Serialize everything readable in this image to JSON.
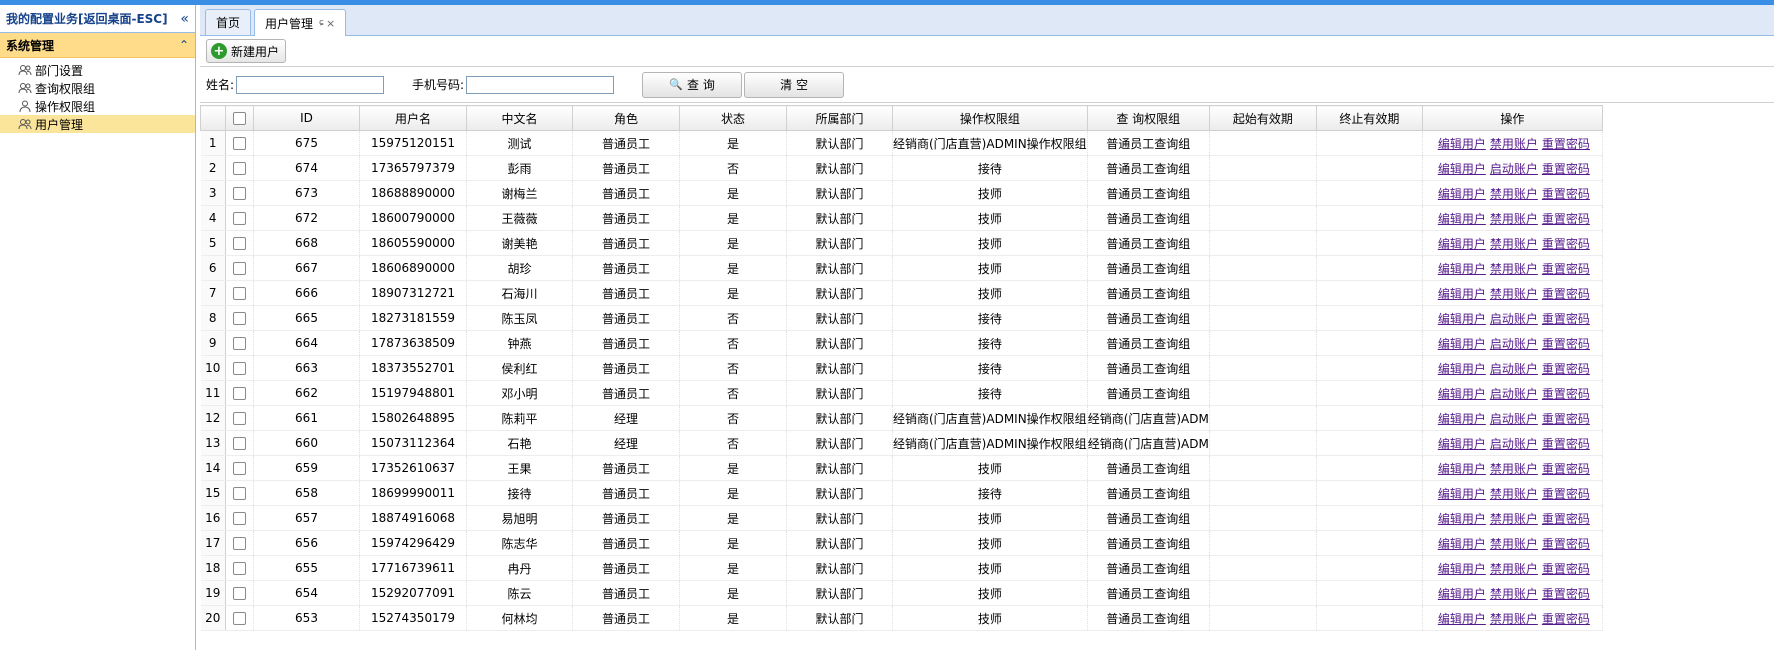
{
  "sidebar": {
    "title": "我的配置业务[返回桌面-ESC]",
    "collapse_icon": "«",
    "group_title": "系统管理",
    "group_toggle": "⌃",
    "items": [
      {
        "label": "部门设置",
        "icon": "users-icon"
      },
      {
        "label": "查询权限组",
        "icon": "users-icon"
      },
      {
        "label": "操作权限组",
        "icon": "user-icon"
      },
      {
        "label": "用户管理",
        "icon": "users-icon"
      }
    ]
  },
  "tabs": [
    {
      "label": "首页"
    },
    {
      "label": "用户管理",
      "pin": "ɕ",
      "close": "×"
    }
  ],
  "toolbar": {
    "new_user_label": "新建用户",
    "plus": "+"
  },
  "search": {
    "name_label": "姓名:",
    "phone_label": "手机号码:",
    "query_label": "查 询",
    "clear_label": "清 空",
    "search_icon": "🔍"
  },
  "table": {
    "headers": [
      "ID",
      "用户名",
      "中文名",
      "角色",
      "状态",
      "所属部门",
      "操作权限组",
      "查 询权限组",
      "起始有效期",
      "终止有效期",
      "操作"
    ],
    "rows": [
      {
        "n": "1",
        "id": "675",
        "user": "15975120151",
        "name": "测试",
        "role": "普通员工",
        "status": "是",
        "dept": "默认部门",
        "op": "经销商(门店直营)ADMIN操作权限组",
        "q": "普通员工查询组",
        "a2": "禁用账户"
      },
      {
        "n": "2",
        "id": "674",
        "user": "17365797379",
        "name": "彭雨",
        "role": "普通员工",
        "status": "否",
        "dept": "默认部门",
        "op": "接待",
        "q": "普通员工查询组",
        "a2": "启动账户"
      },
      {
        "n": "3",
        "id": "673",
        "user": "18688890000",
        "name": "谢梅兰",
        "role": "普通员工",
        "status": "是",
        "dept": "默认部门",
        "op": "技师",
        "q": "普通员工查询组",
        "a2": "禁用账户"
      },
      {
        "n": "4",
        "id": "672",
        "user": "18600790000",
        "name": "王薇薇",
        "role": "普通员工",
        "status": "是",
        "dept": "默认部门",
        "op": "技师",
        "q": "普通员工查询组",
        "a2": "禁用账户"
      },
      {
        "n": "5",
        "id": "668",
        "user": "18605590000",
        "name": "谢美艳",
        "role": "普通员工",
        "status": "是",
        "dept": "默认部门",
        "op": "技师",
        "q": "普通员工查询组",
        "a2": "禁用账户"
      },
      {
        "n": "6",
        "id": "667",
        "user": "18606890000",
        "name": "胡珍",
        "role": "普通员工",
        "status": "是",
        "dept": "默认部门",
        "op": "技师",
        "q": "普通员工查询组",
        "a2": "禁用账户"
      },
      {
        "n": "7",
        "id": "666",
        "user": "18907312721",
        "name": "石海川",
        "role": "普通员工",
        "status": "是",
        "dept": "默认部门",
        "op": "技师",
        "q": "普通员工查询组",
        "a2": "禁用账户"
      },
      {
        "n": "8",
        "id": "665",
        "user": "18273181559",
        "name": "陈玉凤",
        "role": "普通员工",
        "status": "否",
        "dept": "默认部门",
        "op": "接待",
        "q": "普通员工查询组",
        "a2": "启动账户"
      },
      {
        "n": "9",
        "id": "664",
        "user": "17873638509",
        "name": "钟燕",
        "role": "普通员工",
        "status": "否",
        "dept": "默认部门",
        "op": "接待",
        "q": "普通员工查询组",
        "a2": "启动账户"
      },
      {
        "n": "10",
        "id": "663",
        "user": "18373552701",
        "name": "侯利红",
        "role": "普通员工",
        "status": "否",
        "dept": "默认部门",
        "op": "接待",
        "q": "普通员工查询组",
        "a2": "启动账户"
      },
      {
        "n": "11",
        "id": "662",
        "user": "15197948801",
        "name": "邓小明",
        "role": "普通员工",
        "status": "否",
        "dept": "默认部门",
        "op": "接待",
        "q": "普通员工查询组",
        "a2": "启动账户"
      },
      {
        "n": "12",
        "id": "661",
        "user": "15802648895",
        "name": "陈莉平",
        "role": "经理",
        "status": "否",
        "dept": "默认部门",
        "op": "经销商(门店直营)ADMIN操作权限组",
        "q": "经销商(门店直营)ADM",
        "a2": "启动账户"
      },
      {
        "n": "13",
        "id": "660",
        "user": "15073112364",
        "name": "石艳",
        "role": "经理",
        "status": "否",
        "dept": "默认部门",
        "op": "经销商(门店直营)ADMIN操作权限组",
        "q": "经销商(门店直营)ADM",
        "a2": "启动账户"
      },
      {
        "n": "14",
        "id": "659",
        "user": "17352610637",
        "name": "王果",
        "role": "普通员工",
        "status": "是",
        "dept": "默认部门",
        "op": "技师",
        "q": "普通员工查询组",
        "a2": "禁用账户"
      },
      {
        "n": "15",
        "id": "658",
        "user": "18699990011",
        "name": "接待",
        "role": "普通员工",
        "status": "是",
        "dept": "默认部门",
        "op": "接待",
        "q": "普通员工查询组",
        "a2": "禁用账户"
      },
      {
        "n": "16",
        "id": "657",
        "user": "18874916068",
        "name": "易旭明",
        "role": "普通员工",
        "status": "是",
        "dept": "默认部门",
        "op": "技师",
        "q": "普通员工查询组",
        "a2": "禁用账户"
      },
      {
        "n": "17",
        "id": "656",
        "user": "15974296429",
        "name": "陈志华",
        "role": "普通员工",
        "status": "是",
        "dept": "默认部门",
        "op": "技师",
        "q": "普通员工查询组",
        "a2": "禁用账户"
      },
      {
        "n": "18",
        "id": "655",
        "user": "17716739611",
        "name": "冉丹",
        "role": "普通员工",
        "status": "是",
        "dept": "默认部门",
        "op": "技师",
        "q": "普通员工查询组",
        "a2": "禁用账户"
      },
      {
        "n": "19",
        "id": "654",
        "user": "15292077091",
        "name": "陈云",
        "role": "普通员工",
        "status": "是",
        "dept": "默认部门",
        "op": "技师",
        "q": "普通员工查询组",
        "a2": "禁用账户"
      },
      {
        "n": "20",
        "id": "653",
        "user": "15274350179",
        "name": "何林均",
        "role": "普通员工",
        "status": "是",
        "dept": "默认部门",
        "op": "技师",
        "q": "普通员工查询组",
        "a2": "禁用账户"
      }
    ],
    "action_edit": "编辑用户",
    "action_reset": "重置密码"
  }
}
